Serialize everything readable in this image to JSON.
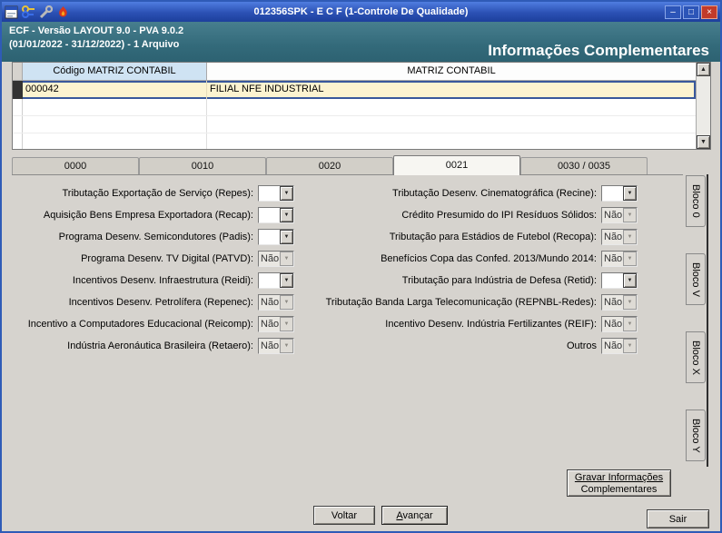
{
  "window": {
    "title": "012356SPK - E C F (1-Controle De Qualidade)",
    "controls": {
      "minimize": "–",
      "maximize": "□",
      "close": "×"
    }
  },
  "icons": {
    "scroll_up": "▲",
    "scroll_down": "▼",
    "combo_arrow": "▼"
  },
  "header": {
    "line1": "ECF - Versão LAYOUT 9.0 - PVA 9.0.2",
    "line2": "(01/01/2022 - 31/12/2022) - 1 Arquivo",
    "title": "Informações Complementares"
  },
  "grid": {
    "columns": [
      "Código MATRIZ CONTABIL",
      "MATRIZ CONTABIL"
    ],
    "rows": [
      {
        "codigo": "000042",
        "nome": "FILIAL NFE INDUSTRIAL"
      }
    ]
  },
  "tabs": {
    "items": [
      "0000",
      "0010",
      "0020",
      "0021",
      "0030 / 0035"
    ],
    "selected": "0021"
  },
  "side_tabs": {
    "items": [
      "Bloco 0",
      "Bloco V",
      "Bloco X",
      "Bloco Y"
    ]
  },
  "fields": {
    "left": [
      {
        "label": "Tributação Exportação de Serviço (Repes):",
        "value": "",
        "enabled": true
      },
      {
        "label": "Aquisição Bens Empresa Exportadora (Recap):",
        "value": "",
        "enabled": true
      },
      {
        "label": "Programa Desenv. Semicondutores (Padis):",
        "value": "",
        "enabled": true
      },
      {
        "label": "Programa Desenv. TV Digital (PATVD):",
        "value": "Não",
        "enabled": false
      },
      {
        "label": "Incentivos Desenv. Infraestrutura (Reidi):",
        "value": "",
        "enabled": true
      },
      {
        "label": "Incentivos Desenv. Petrolífera (Repenec):",
        "value": "Não",
        "enabled": false
      },
      {
        "label": "Incentivo a Computadores Educacional (Reicomp):",
        "value": "Não",
        "enabled": false
      },
      {
        "label": "Indústria Aeronáutica Brasileira (Retaero):",
        "value": "Não",
        "enabled": false
      }
    ],
    "right": [
      {
        "label": "Tributação Desenv. Cinematográfica (Recine):",
        "value": "",
        "enabled": true
      },
      {
        "label": "Crédito Presumido do IPI Resíduos Sólidos:",
        "value": "Não",
        "enabled": false
      },
      {
        "label": "Tributação para Estádios de Futebol (Recopa):",
        "value": "Não",
        "enabled": false
      },
      {
        "label": "Benefícios Copa das Confed. 2013/Mundo 2014:",
        "value": "Não",
        "enabled": false
      },
      {
        "label": "Tributação para Indústria de Defesa (Retid):",
        "value": "",
        "enabled": true
      },
      {
        "label": "Tributação Banda Larga Telecomunicação (REPNBL-Redes):",
        "value": "Não",
        "enabled": false
      },
      {
        "label": "Incentivo Desenv. Indústria Fertilizantes (REIF):",
        "value": "Não",
        "enabled": false
      },
      {
        "label": "Outros",
        "value": "Não",
        "enabled": false
      }
    ]
  },
  "buttons": {
    "gravar_line1": "Gravar Informações",
    "gravar_line2": "Complementares",
    "voltar": "Voltar",
    "avancar_accel": "A",
    "avancar_rest": "vançar",
    "sair": "Sair"
  }
}
